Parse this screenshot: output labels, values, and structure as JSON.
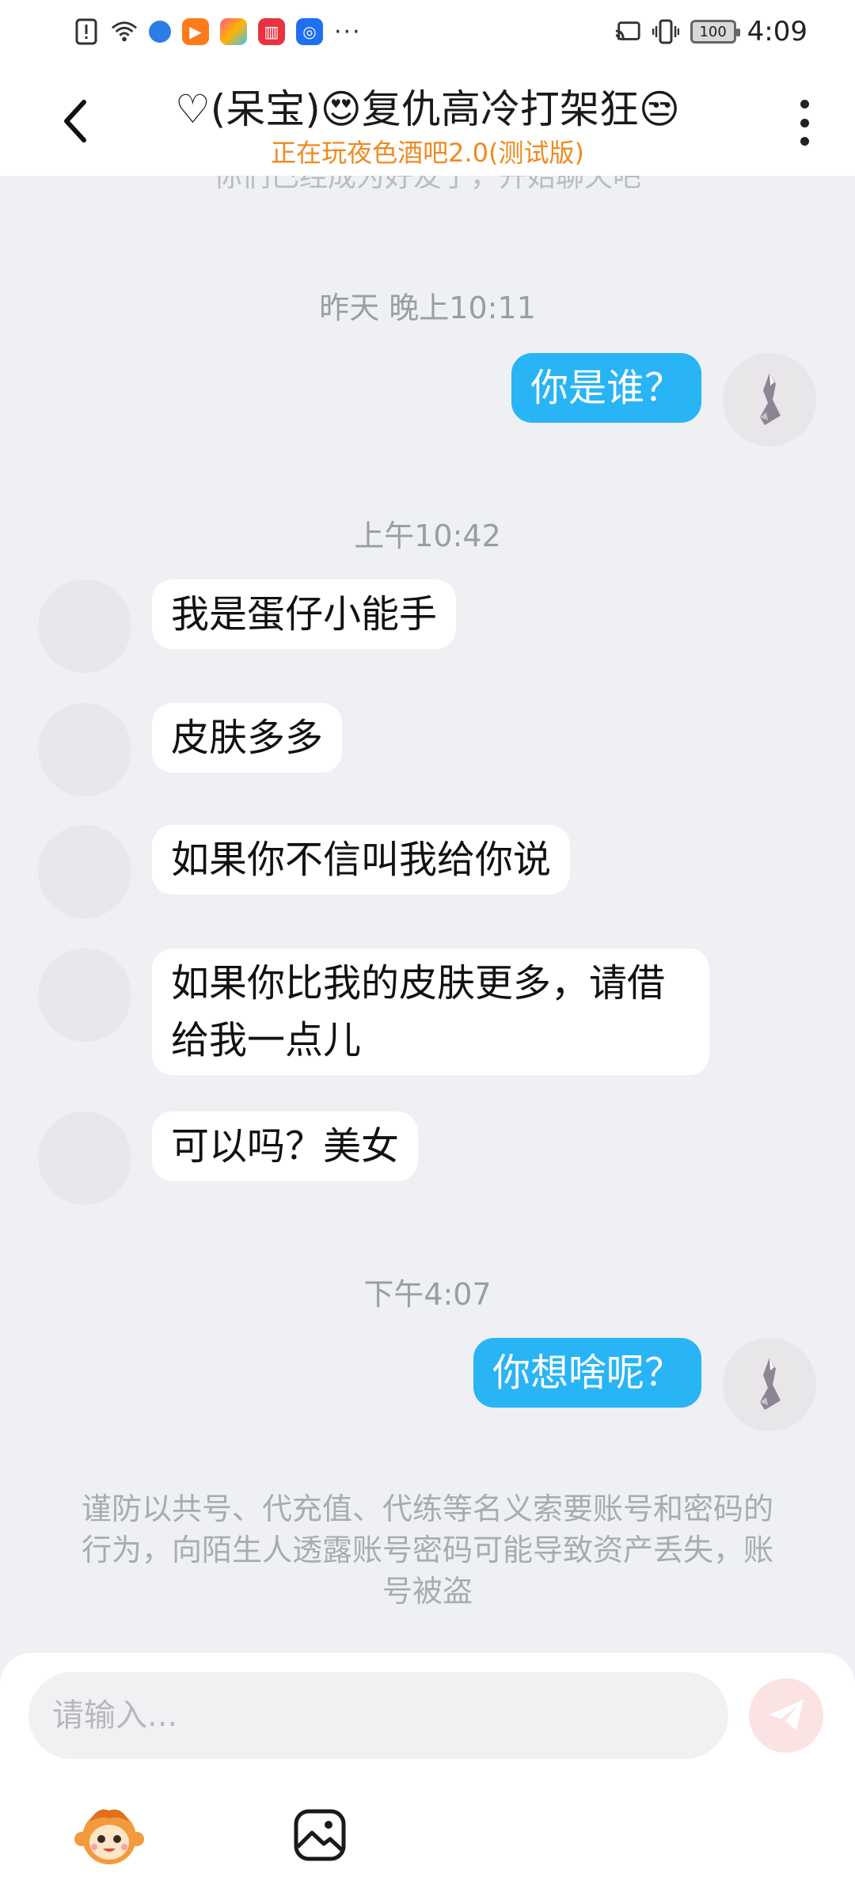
{
  "status_bar": {
    "time": "4:09",
    "battery": "100",
    "more_glyph": "···"
  },
  "header": {
    "title": "♡(呆宝)😍复仇高冷打架狂😒",
    "subtitle": "正在玩夜色酒吧2.0(测试版)"
  },
  "chat": {
    "system_notice": "你们已经成为好友了，开始聊天吧",
    "timestamps": [
      "昨天 晚上10:11",
      "上午10:42",
      "下午4:07"
    ],
    "messages": [
      {
        "from": "me",
        "text": "你是谁？"
      },
      {
        "from": "other",
        "text": "我是蛋仔小能手"
      },
      {
        "from": "other",
        "text": "皮肤多多"
      },
      {
        "from": "other",
        "text": "如果你不信叫我给你说"
      },
      {
        "from": "other",
        "text": "如果你比我的皮肤更多，请借给我一点儿"
      },
      {
        "from": "other",
        "text": "可以吗？美女"
      },
      {
        "from": "me",
        "text": "你想啥呢？"
      }
    ],
    "safety_warning": "谨防以共号、代充值、代练等名义索要账号和密码的行为，向陌生人透露账号密码可能导致资产丢失，账号被盗"
  },
  "composer": {
    "placeholder": "请输入...",
    "icons": [
      "emoji-sticker-icon",
      "image-icon",
      "send-icon"
    ]
  },
  "colors": {
    "accent_orange": "#ee8a1d",
    "bubble_mine": "#28b4f5",
    "send_disabled": "#fbe3e3"
  }
}
